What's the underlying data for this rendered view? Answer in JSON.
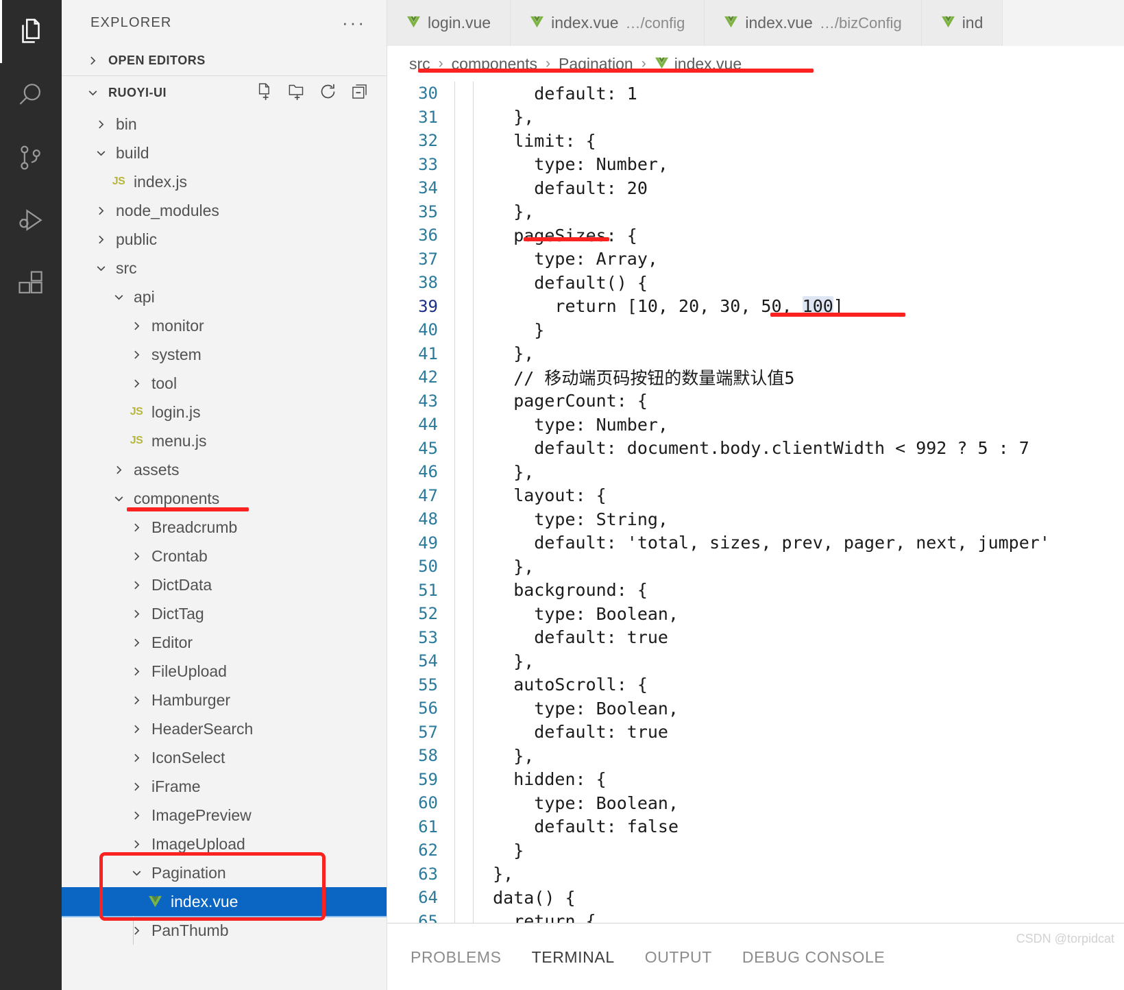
{
  "activitybar": {
    "items": [
      {
        "name": "explorer-icon",
        "active": true
      },
      {
        "name": "search-icon",
        "active": false
      },
      {
        "name": "source-control-icon",
        "active": false
      },
      {
        "name": "run-and-debug-icon",
        "active": false
      },
      {
        "name": "extensions-icon",
        "active": false
      }
    ]
  },
  "sidebar": {
    "title": "EXPLORER",
    "more_actions": "···",
    "open_editors_label": "OPEN EDITORS",
    "root_label": "RUOYI-UI",
    "root_actions": [
      "new-file-icon",
      "new-folder-icon",
      "refresh-icon",
      "collapse-all-icon"
    ],
    "tree": [
      {
        "label": "bin",
        "depth": 1,
        "kind": "folder",
        "state": "collapsed"
      },
      {
        "label": "build",
        "depth": 1,
        "kind": "folder",
        "state": "expanded"
      },
      {
        "label": "index.js",
        "depth": 2,
        "kind": "js"
      },
      {
        "label": "node_modules",
        "depth": 1,
        "kind": "folder",
        "state": "collapsed"
      },
      {
        "label": "public",
        "depth": 1,
        "kind": "folder",
        "state": "collapsed"
      },
      {
        "label": "src",
        "depth": 1,
        "kind": "folder",
        "state": "expanded"
      },
      {
        "label": "api",
        "depth": 2,
        "kind": "folder",
        "state": "expanded"
      },
      {
        "label": "monitor",
        "depth": 3,
        "kind": "folder",
        "state": "collapsed"
      },
      {
        "label": "system",
        "depth": 3,
        "kind": "folder",
        "state": "collapsed"
      },
      {
        "label": "tool",
        "depth": 3,
        "kind": "folder",
        "state": "collapsed"
      },
      {
        "label": "login.js",
        "depth": 3,
        "kind": "js"
      },
      {
        "label": "menu.js",
        "depth": 3,
        "kind": "js"
      },
      {
        "label": "assets",
        "depth": 2,
        "kind": "folder",
        "state": "collapsed"
      },
      {
        "label": "components",
        "depth": 2,
        "kind": "folder",
        "state": "expanded"
      },
      {
        "label": "Breadcrumb",
        "depth": 3,
        "kind": "folder",
        "state": "collapsed"
      },
      {
        "label": "Crontab",
        "depth": 3,
        "kind": "folder",
        "state": "collapsed"
      },
      {
        "label": "DictData",
        "depth": 3,
        "kind": "folder",
        "state": "collapsed"
      },
      {
        "label": "DictTag",
        "depth": 3,
        "kind": "folder",
        "state": "collapsed"
      },
      {
        "label": "Editor",
        "depth": 3,
        "kind": "folder",
        "state": "collapsed"
      },
      {
        "label": "FileUpload",
        "depth": 3,
        "kind": "folder",
        "state": "collapsed"
      },
      {
        "label": "Hamburger",
        "depth": 3,
        "kind": "folder",
        "state": "collapsed"
      },
      {
        "label": "HeaderSearch",
        "depth": 3,
        "kind": "folder",
        "state": "collapsed"
      },
      {
        "label": "IconSelect",
        "depth": 3,
        "kind": "folder",
        "state": "collapsed"
      },
      {
        "label": "iFrame",
        "depth": 3,
        "kind": "folder",
        "state": "collapsed"
      },
      {
        "label": "ImagePreview",
        "depth": 3,
        "kind": "folder",
        "state": "collapsed"
      },
      {
        "label": "ImageUpload",
        "depth": 3,
        "kind": "folder",
        "state": "collapsed"
      },
      {
        "label": "Pagination",
        "depth": 3,
        "kind": "folder",
        "state": "expanded"
      },
      {
        "label": "index.vue",
        "depth": 4,
        "kind": "vue",
        "selected": true
      },
      {
        "label": "PanThumb",
        "depth": 3,
        "kind": "folder",
        "state": "collapsed"
      }
    ]
  },
  "editor": {
    "tabs": [
      {
        "name": "login.vue",
        "sub": ""
      },
      {
        "name": "index.vue",
        "sub": "…/config"
      },
      {
        "name": "index.vue",
        "sub": "…/bizConfig"
      },
      {
        "name": "ind",
        "sub": ""
      }
    ],
    "breadcrumb": [
      "src",
      "components",
      "Pagination",
      "index.vue"
    ],
    "first_line_number": 30,
    "cursor_line": 39,
    "lines": [
      {
        "n": 30,
        "text": "      default: 1"
      },
      {
        "n": 31,
        "text": "    },"
      },
      {
        "n": 32,
        "text": "    limit: {"
      },
      {
        "n": 33,
        "text": "      type: Number,"
      },
      {
        "n": 34,
        "text": "      default: 20"
      },
      {
        "n": 35,
        "text": "    },"
      },
      {
        "n": 36,
        "text": "    pageSizes: {"
      },
      {
        "n": 37,
        "text": "      type: Array,"
      },
      {
        "n": 38,
        "text": "      default() {"
      },
      {
        "n": 39,
        "text": "        return [10, 20, 30, 50, ",
        "hl": "100",
        "tail": "]"
      },
      {
        "n": 40,
        "text": "      }"
      },
      {
        "n": 41,
        "text": "    },"
      },
      {
        "n": 42,
        "text": "    // 移动端页码按钮的数量端默认值5"
      },
      {
        "n": 43,
        "text": "    pagerCount: {"
      },
      {
        "n": 44,
        "text": "      type: Number,"
      },
      {
        "n": 45,
        "text": "      default: document.body.clientWidth < 992 ? 5 : 7"
      },
      {
        "n": 46,
        "text": "    },"
      },
      {
        "n": 47,
        "text": "    layout: {"
      },
      {
        "n": 48,
        "text": "      type: String,"
      },
      {
        "n": 49,
        "text": "      default: 'total, sizes, prev, pager, next, jumper'"
      },
      {
        "n": 50,
        "text": "    },"
      },
      {
        "n": 51,
        "text": "    background: {"
      },
      {
        "n": 52,
        "text": "      type: Boolean,"
      },
      {
        "n": 53,
        "text": "      default: true"
      },
      {
        "n": 54,
        "text": "    },"
      },
      {
        "n": 55,
        "text": "    autoScroll: {"
      },
      {
        "n": 56,
        "text": "      type: Boolean,"
      },
      {
        "n": 57,
        "text": "      default: true"
      },
      {
        "n": 58,
        "text": "    },"
      },
      {
        "n": 59,
        "text": "    hidden: {"
      },
      {
        "n": 60,
        "text": "      type: Boolean,"
      },
      {
        "n": 61,
        "text": "      default: false"
      },
      {
        "n": 62,
        "text": "    }"
      },
      {
        "n": 63,
        "text": "  },"
      },
      {
        "n": 64,
        "text": "  data() {"
      },
      {
        "n": 65,
        "text": "    return {"
      }
    ]
  },
  "panel": {
    "tabs": [
      {
        "label": "PROBLEMS",
        "active": false
      },
      {
        "label": "TERMINAL",
        "active": true
      },
      {
        "label": "OUTPUT",
        "active": false
      },
      {
        "label": "DEBUG CONSOLE",
        "active": false
      }
    ]
  },
  "watermark": "CSDN @torpidcat",
  "colors": {
    "accent_selection": "#0a66c2",
    "annotation_red": "#fb2222",
    "line_number": "#2b7a9b",
    "vue_green": "#7cb342",
    "js_yellow": "#b7b73b"
  }
}
